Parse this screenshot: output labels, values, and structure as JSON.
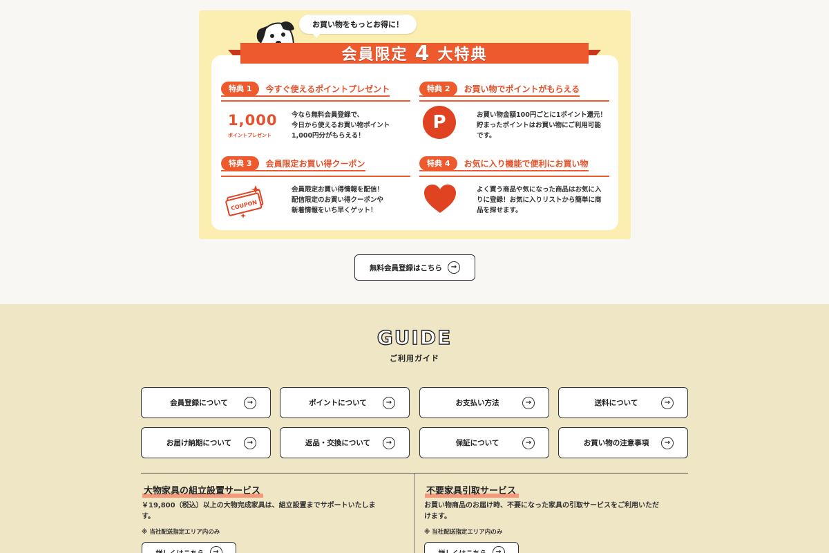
{
  "benefits": {
    "bubble": "お買い物をもっとお得に！",
    "banner_pre": "会員限定",
    "banner_num": "4",
    "banner_post": "大特典",
    "perks": [
      {
        "badge": "特典 1",
        "title": "今すぐ使えるポイントプレゼント",
        "text": [
          "今なら無料会員登録で、",
          "今日から使えるお買い物ポイント",
          "1,000円分がもらえる！"
        ],
        "value": "1,000",
        "caption": "ポイントプレゼント"
      },
      {
        "badge": "特典 2",
        "title": "お買い物でポイントがもらえる",
        "text": [
          "お買い物金額100円ごとに1ポイント還元！",
          "貯まったポイントはお買い物にご利用可能",
          "です。"
        ],
        "icon_letter": "P"
      },
      {
        "badge": "特典 3",
        "title": "会員限定お買い得クーポン",
        "text": [
          "会員限定お買い得情報を配信！",
          "配信限定のお買い得クーポンや",
          "新着情報をいち早くゲット！"
        ],
        "icon_label": "COUPON"
      },
      {
        "badge": "特典 4",
        "title": "お気に入り機能で便利にお買い物",
        "text": [
          "よく買う商品や気になった商品はお気に入",
          "りに登録！お気に入りリストから簡単に商",
          "品を探せます。"
        ]
      }
    ],
    "icons": {
      "p": "point-icon",
      "coupon": "coupon-icon",
      "heart": "heart-icon"
    },
    "accent": "#ec5a2e"
  },
  "register": {
    "label": "無料会員登録はこちら"
  },
  "guide": {
    "title_en": "GUIDE",
    "title_ja": "ご利用ガイド",
    "buttons": [
      "会員登録について",
      "ポイントについて",
      "お支払い方法",
      "送料について",
      "お届け納期について",
      "返品・交換について",
      "保証について",
      "お買い物の注意事項"
    ]
  },
  "services": [
    {
      "title": "大物家具の組立設置サービス",
      "desc": [
        "￥19,800（税込）以上の大物完成家具は、組立設置までサポートいたしま",
        "す。"
      ],
      "note": "※ 当社配送指定エリア内のみ",
      "button": "詳しくはこちら"
    },
    {
      "title": "不要家具引取サービス",
      "desc": [
        "お買い物商品のお届け時、不要になった家具の引取サービスをご利用いただ",
        "けます。"
      ],
      "note": "※ 当社配送指定エリア内のみ",
      "button": "詳しくはこちら"
    }
  ]
}
